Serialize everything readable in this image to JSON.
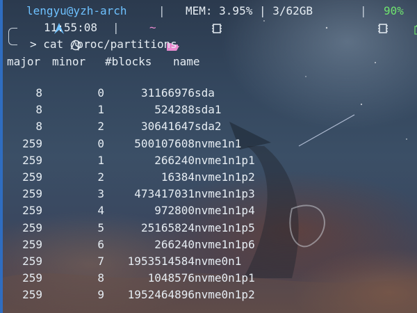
{
  "prompt": {
    "arch_icon": "arch-linux-icon",
    "user_host": "lengyu@yzh-arch",
    "sep": "|",
    "mem_icon": "memory-chip-icon",
    "mem": "MEM: 3.95% | 3/62GB",
    "battery_icon": "battery-icon",
    "battery": "90%",
    "clock_icon": "clock-icon",
    "time": "11:55:08",
    "folder_icon": "folder-open-icon",
    "dir": "~",
    "command": "> cat /proc/partitions"
  },
  "header": {
    "major": "major",
    "minor": "minor",
    "blocks": "#blocks",
    "name": "name"
  },
  "rows": [
    {
      "major": "8",
      "minor": "0",
      "blocks": "31166976",
      "name": "sda"
    },
    {
      "major": "8",
      "minor": "1",
      "blocks": "524288",
      "name": "sda1"
    },
    {
      "major": "8",
      "minor": "2",
      "blocks": "30641647",
      "name": "sda2"
    },
    {
      "major": "259",
      "minor": "0",
      "blocks": "500107608",
      "name": "nvme1n1"
    },
    {
      "major": "259",
      "minor": "1",
      "blocks": "266240",
      "name": "nvme1n1p1"
    },
    {
      "major": "259",
      "minor": "2",
      "blocks": "16384",
      "name": "nvme1n1p2"
    },
    {
      "major": "259",
      "minor": "3",
      "blocks": "473417031",
      "name": "nvme1n1p3"
    },
    {
      "major": "259",
      "minor": "4",
      "blocks": "972800",
      "name": "nvme1n1p4"
    },
    {
      "major": "259",
      "minor": "5",
      "blocks": "25165824",
      "name": "nvme1n1p5"
    },
    {
      "major": "259",
      "minor": "6",
      "blocks": "266240",
      "name": "nvme1n1p6"
    },
    {
      "major": "259",
      "minor": "7",
      "blocks": "1953514584",
      "name": "nvme0n1"
    },
    {
      "major": "259",
      "minor": "8",
      "blocks": "1048576",
      "name": "nvme0n1p1"
    },
    {
      "major": "259",
      "minor": "9",
      "blocks": "1952464896",
      "name": "nvme0n1p2"
    }
  ]
}
